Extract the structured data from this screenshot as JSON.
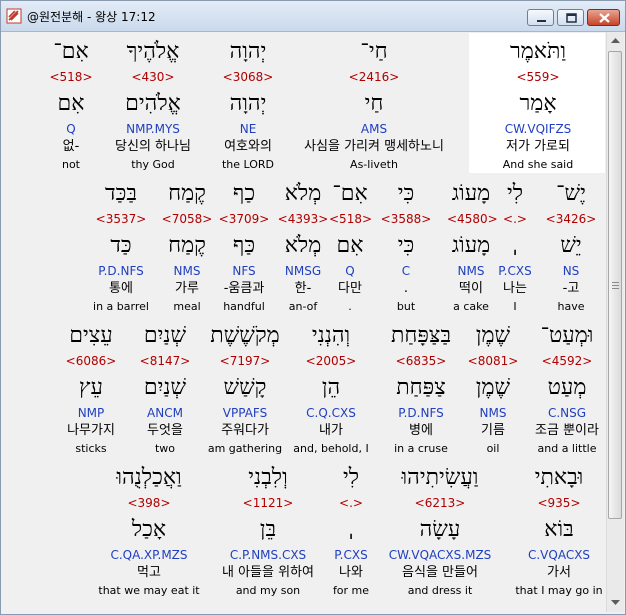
{
  "window": {
    "title": "@원전분해 - 왕상 17:12"
  },
  "lines": [
    [
      {
        "heb": "וַתֹּאמֶר",
        "strong": "<559>",
        "lemma": "אָמַר",
        "morph": "CW.VQIFZS",
        "kor": "저가 가로되",
        "eng": "And she said"
      },
      {
        "heb": "חַי־",
        "strong": "<2416>",
        "lemma": "חַי",
        "morph": "AMS",
        "kor": "사심을 가리켜 맹세하노니",
        "eng": "As-liveth"
      },
      {
        "heb": "יְהוָה",
        "strong": "<3068>",
        "lemma": "יְהוָה",
        "morph": "NE",
        "kor": "여호와의",
        "eng": "the LORD"
      },
      {
        "heb": "אֱלֹהֶיךָ",
        "strong": "<430>",
        "lemma": "אֱלֹהִים",
        "morph": "NMP.MYS",
        "kor": "당신의 하나님",
        "eng": "thy God"
      },
      {
        "heb": "אִם־",
        "strong": "<518>",
        "lemma": "אִם",
        "morph": "Q",
        "kor": "없-",
        "eng": "not"
      }
    ],
    [
      {
        "heb": "יֶשׁ־",
        "strong": "<3426>",
        "lemma": "יֵשׁ",
        "morph": "NS",
        "kor": "-고",
        "eng": "have"
      },
      {
        "heb": "לִי",
        "strong": "<.>",
        "lemma": "ˌ",
        "morph": "P.CXS",
        "kor": "나는",
        "eng": "I"
      },
      {
        "heb": "מָעוֹג",
        "strong": "<4580>",
        "lemma": "מָעוֹג",
        "morph": "NMS",
        "kor": "떡이",
        "eng": "a cake"
      },
      {
        "heb": "כִּי",
        "strong": "<3588>",
        "lemma": "כִּי",
        "morph": "C",
        "kor": ".",
        "eng": "but"
      },
      {
        "heb": "אִם־",
        "strong": "<518>",
        "lemma": "אִם",
        "morph": "Q",
        "kor": "다만",
        "eng": "."
      },
      {
        "heb": "מְלֹא",
        "strong": "<4393>",
        "lemma": "מְלֹא",
        "morph": "NMSG",
        "kor": "한-",
        "eng": "an-of"
      },
      {
        "heb": "כַף",
        "strong": "<3709>",
        "lemma": "כַּף",
        "morph": "NFS",
        "kor": "-움큼과",
        "eng": "handful"
      },
      {
        "heb": "קֶמַח",
        "strong": "<7058>",
        "lemma": "קֶמַח",
        "morph": "NMS",
        "kor": "가루",
        "eng": "meal"
      },
      {
        "heb": "בַּכַּד",
        "strong": "<3537>",
        "lemma": "כַּד",
        "morph": "P.D.NFS",
        "kor": "통에",
        "eng": "in a barrel"
      }
    ],
    [
      {
        "heb": "וּמְעַט־",
        "strong": "<4592>",
        "lemma": "מְעַט",
        "morph": "C.NSG",
        "kor": "조금 뿐이라",
        "eng": "and a little"
      },
      {
        "heb": "שֶׁמֶן",
        "strong": "<8081>",
        "lemma": "שֶׁמֶן",
        "morph": "NMS",
        "kor": "기름",
        "eng": "oil"
      },
      {
        "heb": "בַּצַּפָּחַת",
        "strong": "<6835>",
        "lemma": "צַפַּחַת",
        "morph": "P.D.NFS",
        "kor": "병에",
        "eng": "in a cruse"
      },
      {
        "heb": "וְהִנְנִי",
        "strong": "<2005>",
        "lemma": "הֵן",
        "morph": "C.Q.CXS",
        "kor": "내가",
        "eng": "and, behold, I"
      },
      {
        "heb": "מְקֹשֶׁשֶׁת",
        "strong": "<7197>",
        "lemma": "קָשַׁשׁ",
        "morph": "VPPAFS",
        "kor": "주워다가",
        "eng": "am gathering"
      },
      {
        "heb": "שְׁנַיִם",
        "strong": "<8147>",
        "lemma": "שְׁנַיִם",
        "morph": "ANCM",
        "kor": "두엇을",
        "eng": "two"
      },
      {
        "heb": "עֵצִים",
        "strong": "<6086>",
        "lemma": "עֵץ",
        "morph": "NMP",
        "kor": "나무가지",
        "eng": "sticks"
      }
    ],
    [
      {
        "heb": "וּבָאתִי",
        "strong": "<935>",
        "lemma": "בּוֹא",
        "morph": "C.VQACXS",
        "kor": "가서",
        "eng": "that I may go in"
      },
      {
        "heb": "וַעֲשִׂיתִיהוּ",
        "strong": "<6213>",
        "lemma": "עָשָׂה",
        "morph": "CW.VQACXS.MZS",
        "kor": "음식을 만들어",
        "eng": "and dress it"
      },
      {
        "heb": "לִי",
        "strong": "<.>",
        "lemma": "ˌ",
        "morph": "P.CXS",
        "kor": "나와",
        "eng": "for me"
      },
      {
        "heb": "וְלִבְנִי",
        "strong": "<1121>",
        "lemma": "בֵּן",
        "morph": "C.P.NMS.CXS",
        "kor": "내 아들을 위하여",
        "eng": "and my son"
      },
      {
        "heb": "וַאֲכַלְנֻהוּ",
        "strong": "<398>",
        "lemma": "אָכַל",
        "morph": "C.QA.XP.MZS",
        "kor": "먹고",
        "eng": "that we may eat it"
      }
    ]
  ]
}
